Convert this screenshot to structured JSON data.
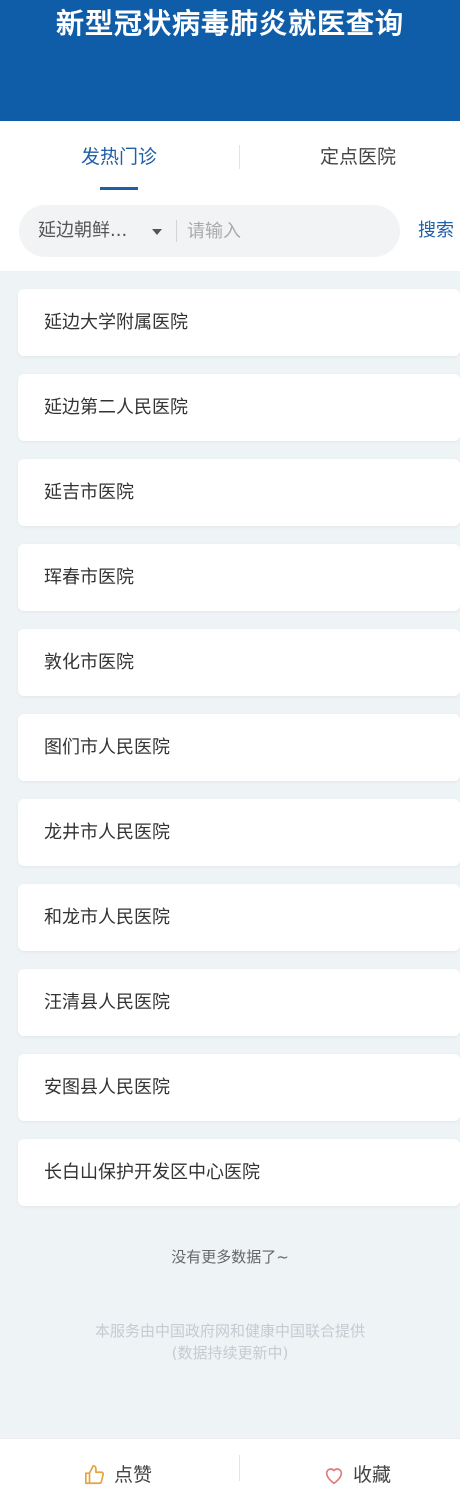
{
  "header": {
    "title": "新型冠状病毒肺炎就医查询"
  },
  "tabs": [
    {
      "label": "发热门诊",
      "active": true
    },
    {
      "label": "定点医院",
      "active": false
    }
  ],
  "search": {
    "region": "延边朝鲜...",
    "placeholder": "请输入",
    "value": "",
    "button_label": "搜索"
  },
  "hospitals": [
    "延边大学附属医院",
    "延边第二人民医院",
    "延吉市医院",
    "珲春市医院",
    "敦化市医院",
    "图们市人民医院",
    "龙井市人民医院",
    "和龙市人民医院",
    "汪清县人民医院",
    "安图县人民医院",
    "长白山保护开发区中心医院"
  ],
  "list_end_text": "没有更多数据了~",
  "footer_note": {
    "line1": "本服务由中国政府网和健康中国联合提供",
    "line2": "(数据持续更新中)"
  },
  "bottom_bar": {
    "like_label": "点赞",
    "favorite_label": "收藏"
  },
  "colors": {
    "header_bg": "#0f5ca8",
    "accent": "#1f5fa5",
    "like_icon": "#e6a23c",
    "favorite_icon": "#e07b7b"
  },
  "icons": {
    "like": "thumbs-up-icon",
    "favorite": "heart-icon",
    "dropdown": "caret-down-icon"
  }
}
